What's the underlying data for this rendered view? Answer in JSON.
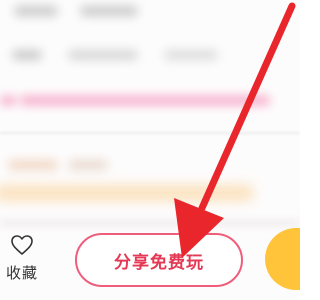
{
  "bottom_bar": {
    "favorite": {
      "icon": "heart-outline-icon",
      "label": "收藏"
    },
    "share_button": {
      "label": "分享免费玩",
      "border_color": "#ef5d7a",
      "text_color": "#e43855"
    },
    "primary_button": {
      "color": "#ffc43a"
    }
  },
  "annotation": {
    "icon": "red-arrow-icon",
    "color": "#e8262b"
  }
}
